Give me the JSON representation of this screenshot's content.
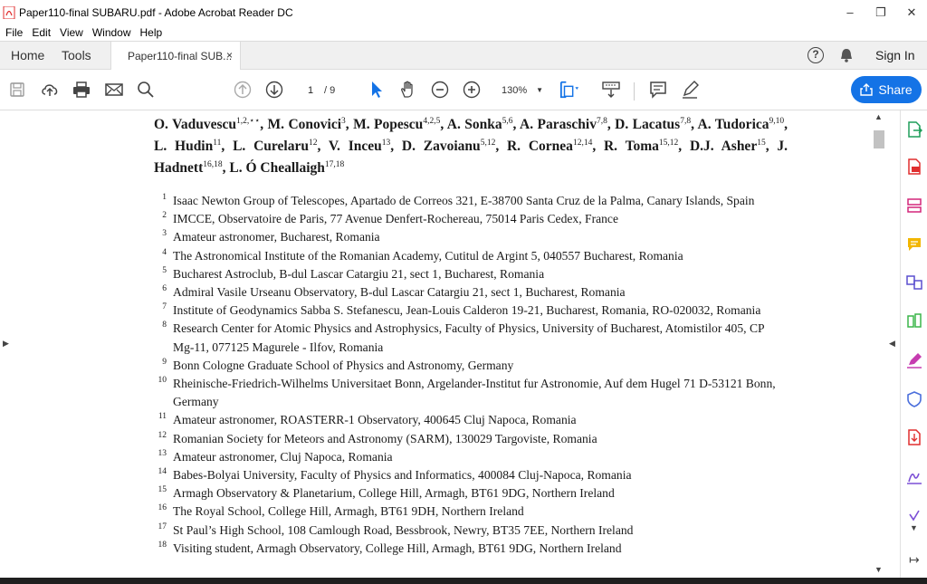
{
  "window": {
    "title": "Paper110-final SUBARU.pdf - Adobe Acrobat Reader DC",
    "controls": {
      "minimize": "–",
      "maximize": "❐",
      "close": "✕"
    }
  },
  "menu": [
    "File",
    "Edit",
    "View",
    "Window",
    "Help"
  ],
  "tabs": {
    "home": "Home",
    "tools": "Tools",
    "document": "Paper110-final SUB...",
    "close": "×",
    "help": "?",
    "sign_in": "Sign In"
  },
  "toolbar": {
    "current_page": "1",
    "page_total": "/ 9",
    "zoom": "130%",
    "share_label": "Share",
    "icons": [
      "save-icon",
      "upload-icon",
      "print-icon",
      "email-icon",
      "search-icon",
      "page-up-icon",
      "page-down-icon",
      "select-cursor-icon",
      "hand-icon",
      "zoom-out-icon",
      "zoom-in-icon",
      "fit-page-icon",
      "scroll-mode-icon",
      "comment-icon",
      "pen-icon"
    ]
  },
  "paper": {
    "authors_html": "O. Vaduvescu<sup>1,2,⋆⋆</sup>, M. Conovici<sup>3</sup>, M. Popescu<sup>4,2,5</sup>, A. Sonka<sup>5,6</sup>, A. Paraschiv<sup>7,8</sup>, D. Lacatus<sup>7,8</sup>, A. Tudorica<sup>9,10</sup>, L. Hudin<sup>11</sup>, L. Curelaru<sup>12</sup>, V. Inceu<sup>13</sup>, D. Zavoianu<sup>5,12</sup>, R. Cornea<sup>12,14</sup>, R. Toma<sup>15,12</sup>, D.J. Asher<sup>15</sup>, J. Hadnett<sup>16,18</sup>, L. Ó Cheallaigh<sup>17,18</sup>",
    "affiliations": [
      {
        "num": "1",
        "text": "Isaac Newton Group of Telescopes, Apartado de Correos 321, E-38700 Santa Cruz de la Palma, Canary Islands, Spain"
      },
      {
        "num": "2",
        "text": "IMCCE, Observatoire de Paris, 77 Avenue Denfert-Rochereau, 75014 Paris Cedex, France"
      },
      {
        "num": "3",
        "text": "Amateur astronomer, Bucharest, Romania"
      },
      {
        "num": "4",
        "text": "The Astronomical Institute of the Romanian Academy, Cutitul de Argint 5, 040557 Bucharest, Romania"
      },
      {
        "num": "5",
        "text": "Bucharest Astroclub, B-dul Lascar Catargiu 21, sect 1, Bucharest, Romania"
      },
      {
        "num": "6",
        "text": "Admiral Vasile Urseanu Observatory, B-dul Lascar Catargiu 21, sect 1, Bucharest, Romania"
      },
      {
        "num": "7",
        "text": "Institute of Geodynamics Sabba S. Stefanescu, Jean-Louis Calderon 19-21, Bucharest, Romania, RO-020032, Romania"
      },
      {
        "num": "8",
        "text": "Research Center for Atomic Physics and Astrophysics, Faculty of Physics, University of Bucharest, Atomistilor 405, CP Mg-11, 077125 Magurele - Ilfov, Romania"
      },
      {
        "num": "9",
        "text": "Bonn Cologne Graduate School of Physics and Astronomy, Germany"
      },
      {
        "num": "10",
        "text": "Rheinische-Friedrich-Wilhelms Universitaet Bonn, Argelander-Institut fur Astronomie, Auf dem Hugel 71 D-53121 Bonn, Germany"
      },
      {
        "num": "11",
        "text": "Amateur astronomer, ROASTERR-1 Observatory, 400645 Cluj Napoca, Romania"
      },
      {
        "num": "12",
        "text": "Romanian Society for Meteors and Astronomy (SARM), 130029 Targoviste, Romania"
      },
      {
        "num": "13",
        "text": "Amateur astronomer, Cluj Napoca, Romania"
      },
      {
        "num": "14",
        "text": "Babes-Bolyai University, Faculty of Physics and Informatics, 400084 Cluj-Napoca, Romania"
      },
      {
        "num": "15",
        "text": "Armagh Observatory & Planetarium, College Hill, Armagh, BT61 9DG, Northern Ireland"
      },
      {
        "num": "16",
        "text": "The Royal School, College Hill, Armagh, BT61 9DH, Northern Ireland"
      },
      {
        "num": "17",
        "text": "St Paul’s High School, 108 Camlough Road, Bessbrook, Newry, BT35 7EE, Northern Ireland"
      },
      {
        "num": "18",
        "text": "Visiting student, Armagh Observatory, College Hill, Armagh, BT61 9DG, Northern Ireland"
      }
    ]
  },
  "right_rail": [
    "export-pdf-icon",
    "create-pdf-icon",
    "edit-pdf-icon",
    "comment-tool-icon",
    "combine-files-icon",
    "organize-pages-icon",
    "fill-sign-icon",
    "protect-icon",
    "compress-pdf-icon",
    "request-signature-icon",
    "more-tools-icon"
  ],
  "colors": {
    "accent": "#1473e6",
    "acrobat_red": "#e02f2f"
  }
}
